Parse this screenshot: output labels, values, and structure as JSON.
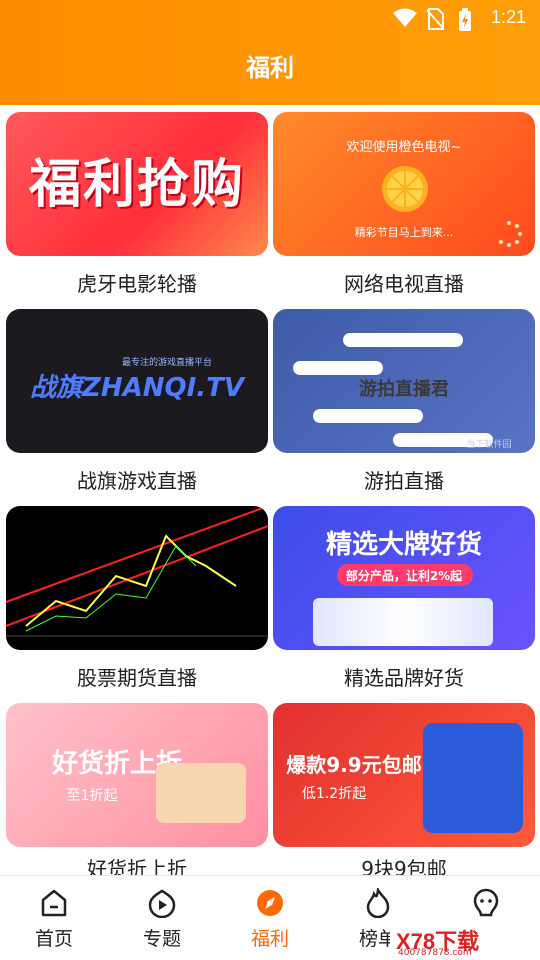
{
  "status_bar": {
    "time": "1:21"
  },
  "header": {
    "title": "福利"
  },
  "cards": [
    {
      "caption": "虎牙电影轮播",
      "thumb_text": "福利抢购"
    },
    {
      "caption": "网络电视直播",
      "thumb_text": "欢迎使用橙色电视~",
      "thumb_sub": "精彩节目马上到来..."
    },
    {
      "caption": "战旗游戏直播",
      "thumb_text": "战旗ZHANQI.TV",
      "thumb_sub": "最专注的游戏直播平台"
    },
    {
      "caption": "游拍直播",
      "thumb_text": "游拍直播君",
      "thumb_sub": "当下软件园"
    },
    {
      "caption": "股票期货直播",
      "thumb_text": ""
    },
    {
      "caption": "精选品牌好货",
      "thumb_text": "精选大牌好货",
      "thumb_sub": "部分产品，让利2%起"
    },
    {
      "caption": "好货折上折",
      "thumb_text": "好货折上折",
      "thumb_sub": "至1折起"
    },
    {
      "caption": "9块9包邮",
      "thumb_text": "爆款9.9元包邮",
      "thumb_sub": "低1.2折起"
    }
  ],
  "tabbar": {
    "items": [
      {
        "label": "首页",
        "icon": "home-icon"
      },
      {
        "label": "专题",
        "icon": "play-icon"
      },
      {
        "label": "福利",
        "icon": "compass-icon",
        "active": true
      },
      {
        "label": "榜单",
        "icon": "flame-icon"
      },
      {
        "label": "我的",
        "icon": "profile-icon"
      }
    ]
  },
  "watermark": {
    "text": "X78下载",
    "sub": "400787878.com"
  }
}
